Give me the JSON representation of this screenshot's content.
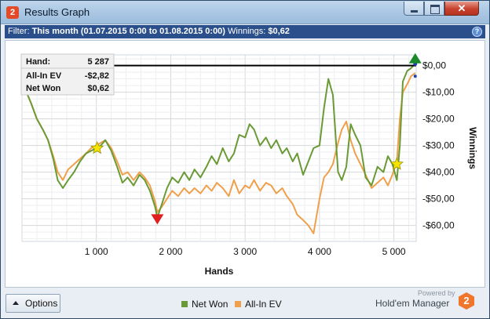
{
  "window": {
    "title": "Results Graph",
    "app_icon": "2",
    "close_glyph": "✕"
  },
  "filter": {
    "label": "Filter:",
    "value": "This month (01.07.2015 0:00 to 01.08.2015 0:00)",
    "winnings_label": "Winnings:",
    "winnings_value": "$0,62",
    "help_glyph": "?"
  },
  "tooltip": {
    "rows": [
      {
        "label": "Hand:",
        "value": "5 287"
      },
      {
        "label": "All-In EV",
        "value": "-$2,82"
      },
      {
        "label": "Net Won",
        "value": "$0,62"
      }
    ]
  },
  "chart_data": {
    "type": "line",
    "xlabel": "Hands",
    "ylabel": "Winnings",
    "xlim": [
      0,
      5300
    ],
    "ylim": [
      -66,
      4
    ],
    "xticks": [
      1000,
      2000,
      3000,
      4000,
      5000
    ],
    "xtick_labels": [
      "1 000",
      "2 000",
      "3 000",
      "4 000",
      "5 000"
    ],
    "yticks": [
      0,
      -10,
      -20,
      -30,
      -40,
      -50,
      -60
    ],
    "ytick_labels": [
      "$0,00",
      "-$10,00",
      "-$20,00",
      "-$30,00",
      "-$40,00",
      "-$50,00",
      "-$60,00"
    ],
    "grid": true,
    "legend_position": "bottom-center",
    "colors": {
      "net_won": "#6a9a35",
      "all_in_ev": "#f0a04b",
      "hairline": "#000000",
      "max_marker": "#1a8a2a",
      "min_marker": "#e02020",
      "star": "#f5e400"
    },
    "series": [
      {
        "name": "Net Won",
        "x": [
          0,
          60,
          120,
          200,
          280,
          350,
          420,
          480,
          550,
          620,
          700,
          780,
          860,
          930,
          1000,
          1060,
          1120,
          1200,
          1280,
          1350,
          1420,
          1500,
          1580,
          1650,
          1720,
          1790,
          1820,
          1880,
          1950,
          2020,
          2100,
          2180,
          2250,
          2320,
          2400,
          2480,
          2550,
          2620,
          2700,
          2780,
          2850,
          2920,
          3000,
          3060,
          3120,
          3200,
          3280,
          3350,
          3420,
          3500,
          3560,
          3640,
          3700,
          3780,
          3850,
          3920,
          4000,
          4060,
          4120,
          4180,
          4250,
          4300,
          4360,
          4420,
          4480,
          4550,
          4620,
          4700,
          4780,
          4860,
          4920,
          4980,
          5040,
          5080,
          5120,
          5180,
          5230,
          5287
        ],
        "values": [
          -6,
          -10,
          -14,
          -20,
          -24,
          -28,
          -35,
          -43,
          -46,
          -43,
          -40,
          -36,
          -33,
          -32,
          -31,
          -30,
          -28,
          -32,
          -38,
          -44,
          -42,
          -45,
          -41,
          -43,
          -47,
          -53,
          -57,
          -52,
          -46,
          -42,
          -44,
          -40,
          -43,
          -39,
          -42,
          -38,
          -34,
          -37,
          -31,
          -36,
          -33,
          -26,
          -27,
          -22,
          -24,
          -30,
          -27,
          -31,
          -28,
          -33,
          -31,
          -36,
          -33,
          -41,
          -36,
          -31,
          -30,
          -16,
          -5,
          -11,
          -40,
          -43,
          -38,
          -22,
          -26,
          -30,
          -42,
          -45,
          -38,
          -40,
          -34,
          -37,
          -43,
          -30,
          -6,
          -2,
          -1,
          0.62
        ]
      },
      {
        "name": "All-In EV",
        "x": [
          0,
          60,
          120,
          200,
          280,
          350,
          420,
          480,
          550,
          620,
          700,
          780,
          860,
          930,
          1000,
          1060,
          1120,
          1200,
          1280,
          1350,
          1420,
          1500,
          1580,
          1650,
          1720,
          1790,
          1820,
          1880,
          1950,
          2020,
          2100,
          2180,
          2250,
          2320,
          2400,
          2480,
          2550,
          2620,
          2700,
          2780,
          2850,
          2920,
          3000,
          3060,
          3120,
          3200,
          3280,
          3350,
          3420,
          3500,
          3560,
          3640,
          3700,
          3780,
          3850,
          3920,
          4000,
          4060,
          4120,
          4180,
          4250,
          4300,
          4360,
          4420,
          4480,
          4550,
          4620,
          4700,
          4780,
          4860,
          4920,
          4980,
          5040,
          5080,
          5120,
          5180,
          5230,
          5287
        ],
        "values": [
          -6,
          -10,
          -14,
          -20,
          -24,
          -28,
          -34,
          -40,
          -43,
          -39,
          -37,
          -35,
          -33,
          -31,
          -30,
          -29,
          -28,
          -31,
          -36,
          -41,
          -40,
          -43,
          -40,
          -42,
          -45,
          -51,
          -55,
          -53,
          -50,
          -47,
          -49,
          -46,
          -48,
          -46,
          -48,
          -45,
          -47,
          -44,
          -46,
          -49,
          -43,
          -48,
          -45,
          -46,
          -43,
          -47,
          -44,
          -45,
          -48,
          -46,
          -49,
          -52,
          -56,
          -58,
          -60,
          -63,
          -50,
          -42,
          -40,
          -37,
          -29,
          -24,
          -21,
          -28,
          -33,
          -37,
          -41,
          -46,
          -44,
          -42,
          -45,
          -41,
          -36,
          -20,
          -10,
          -7,
          -4,
          -2.82
        ]
      }
    ],
    "markers": [
      {
        "kind": "max",
        "x": 5287,
        "y": 2
      },
      {
        "kind": "min",
        "x": 1820,
        "y": -57
      },
      {
        "kind": "star",
        "x": 1010,
        "y": -31
      },
      {
        "kind": "star",
        "x": 5040,
        "y": -37
      }
    ],
    "hairline_y": 0
  },
  "bottom": {
    "options_label": "Options",
    "legend": [
      {
        "name": "Net Won",
        "color": "#6a9a35"
      },
      {
        "name": "All-In EV",
        "color": "#f0a04b"
      }
    ],
    "powered_by": "Powered by",
    "brand": "Hold'em Manager",
    "brand_badge": "2"
  }
}
